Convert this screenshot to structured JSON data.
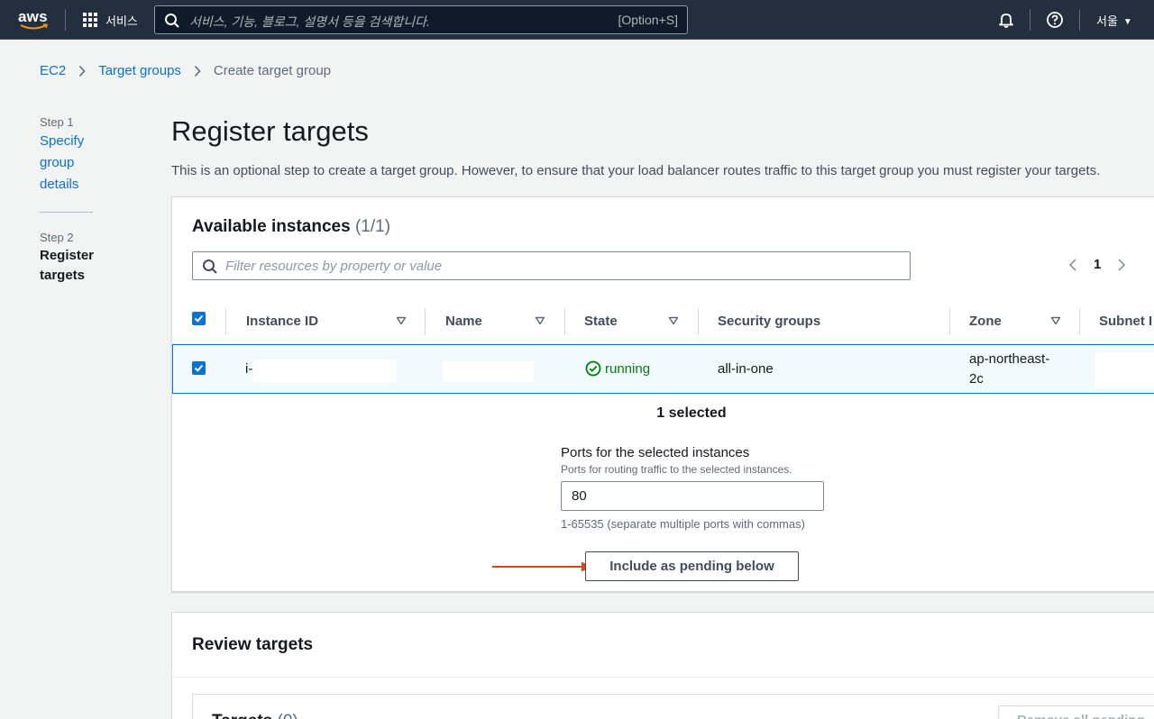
{
  "topnav": {
    "logo_text": "aws",
    "services_label": "서비스",
    "search_placeholder": "서비스, 기능, 블로그, 설명서 등을 검색합니다.",
    "search_shortcut": "[Option+S]",
    "region_label": "서울",
    "icons": [
      "grid-icon",
      "search-icon",
      "bell-icon",
      "help-icon",
      "caret-down-icon"
    ],
    "bg_color": "#232f3e"
  },
  "breadcrumb": {
    "items": [
      "EC2",
      "Target groups",
      "Create target group"
    ]
  },
  "steps": {
    "step1_label": "Step 1",
    "step1_title_lines": [
      "Specify",
      "group",
      "details"
    ],
    "step2_label": "Step 2",
    "step2_title_lines": [
      "Register",
      "targets"
    ]
  },
  "page": {
    "title": "Register targets",
    "description": "This is an optional step to create a target group. However, to ensure that your load balancer routes traffic to this target group you must register your targets."
  },
  "available": {
    "title": "Available instances",
    "count": "(1/1)",
    "filter_placeholder": "Filter resources by property or value",
    "page_number": "1",
    "columns": [
      "Instance ID",
      "Name",
      "State",
      "Security groups",
      "Zone",
      "Subnet I"
    ],
    "rows": [
      {
        "checked": true,
        "instance_id": "i-",
        "name": "",
        "state": "running",
        "security_groups": "all-in-one",
        "zone_line1": "ap-northeast-",
        "zone_line2": "2c"
      }
    ],
    "selected_text": "1 selected",
    "ports_label": "Ports for the selected instances",
    "ports_description": "Ports for routing traffic to the selected instances.",
    "ports_value": "80",
    "ports_hint": "1-65535 (separate multiple ports with commas)",
    "include_button": "Include as pending below"
  },
  "review": {
    "title": "Review targets",
    "targets_title": "Targets",
    "targets_count": "(0)",
    "remove_button": "Remove all pending"
  },
  "colors": {
    "link": "#0972d3",
    "running": "#037f0c",
    "annotation_arrow": "#e0431f",
    "selected_row_bg": "#f1faff"
  }
}
